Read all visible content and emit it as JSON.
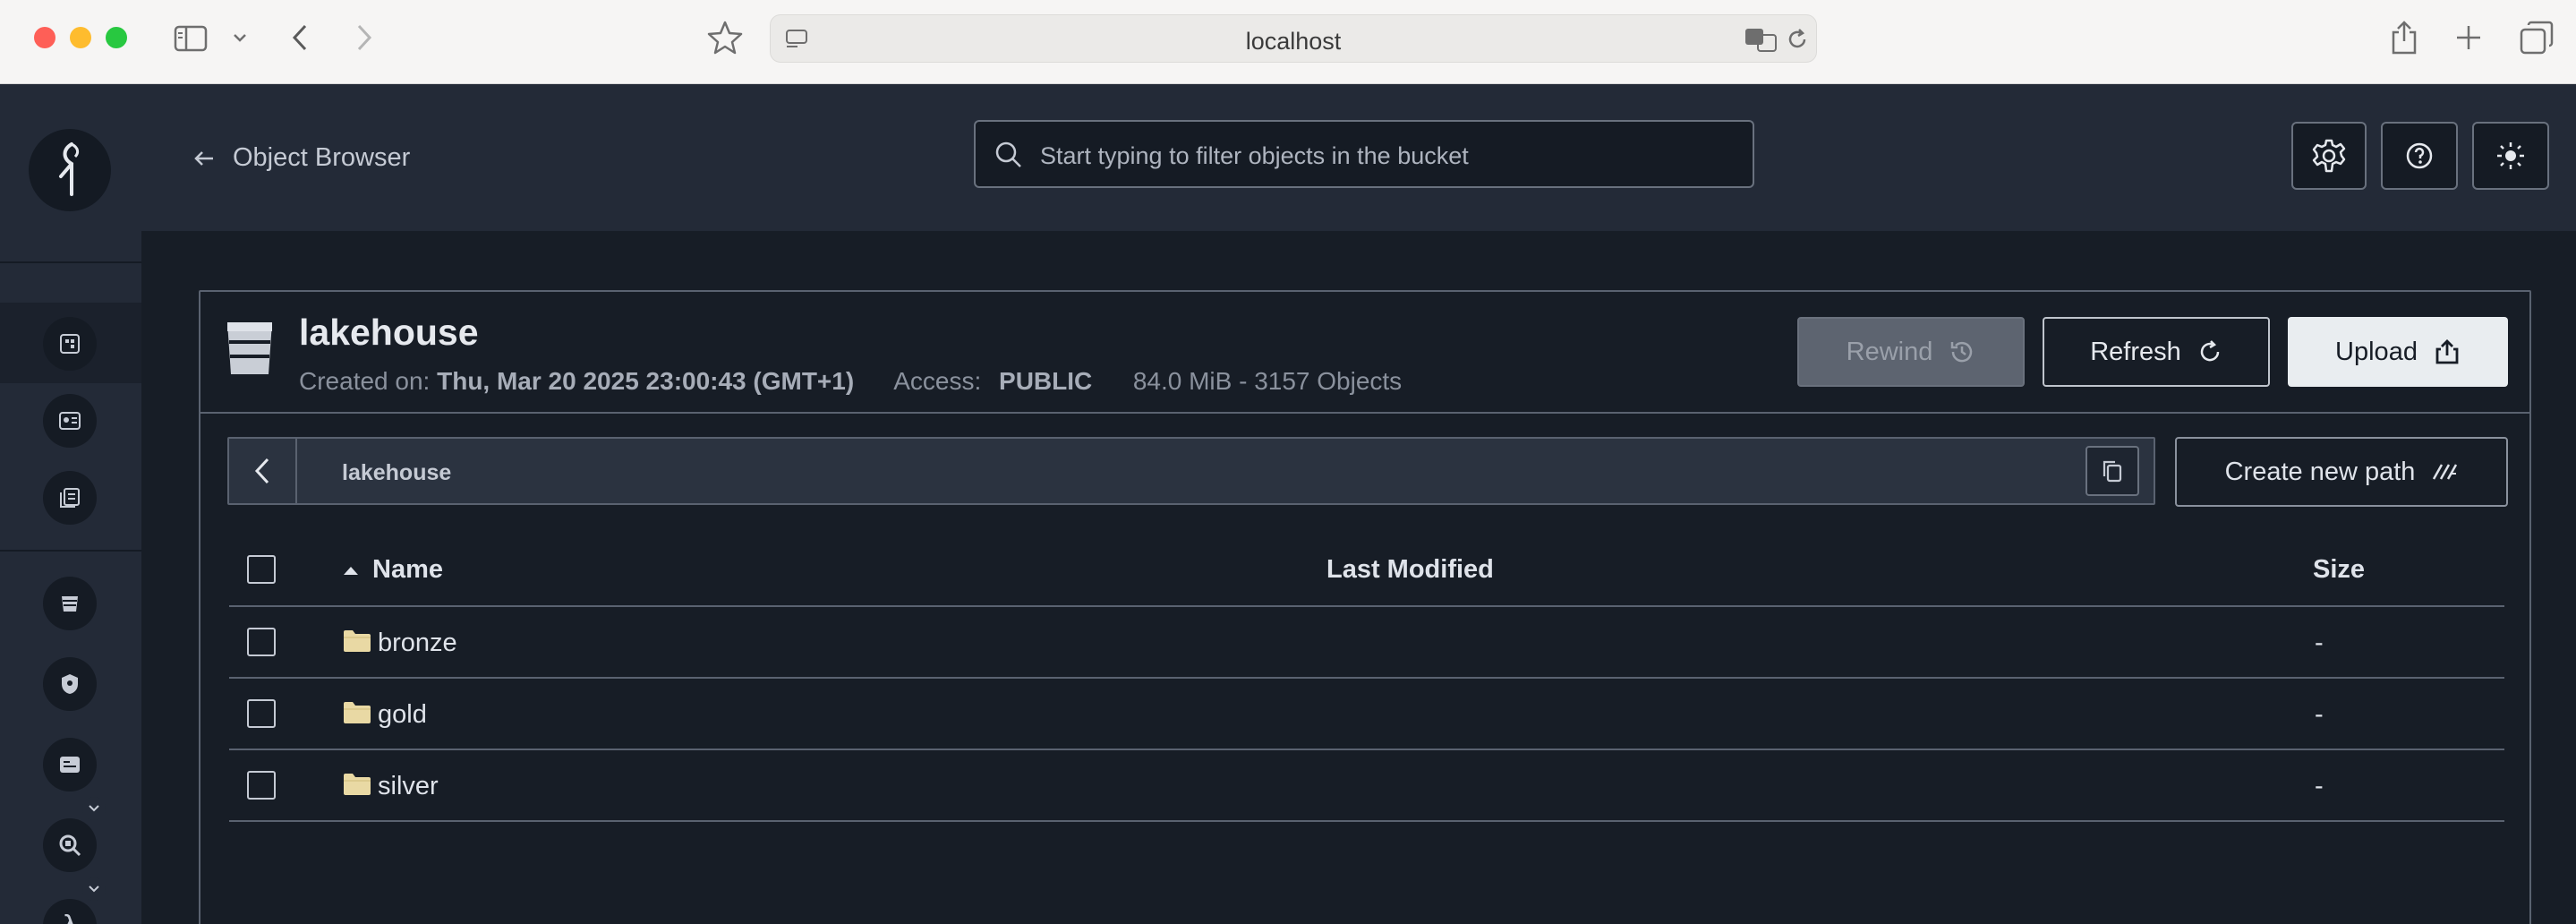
{
  "browser": {
    "url": "localhost"
  },
  "header": {
    "back_label": "Object Browser",
    "search_placeholder": "Start typing to filter objects in the bucket"
  },
  "bucket": {
    "name": "lakehouse",
    "created_label": "Created on:",
    "created_value": "Thu, Mar 20 2025 23:00:43 (GMT+1)",
    "access_label": "Access:",
    "access_value": "PUBLIC",
    "stats": "84.0 MiB - 3157 Objects"
  },
  "actions": {
    "rewind": "Rewind",
    "refresh": "Refresh",
    "upload": "Upload",
    "create_path": "Create new path"
  },
  "path": {
    "current": "lakehouse"
  },
  "table": {
    "columns": {
      "name": "Name",
      "last_modified": "Last Modified",
      "size": "Size"
    },
    "rows": [
      {
        "name": "bronze",
        "last_modified": "",
        "size": "-"
      },
      {
        "name": "gold",
        "last_modified": "",
        "size": "-"
      },
      {
        "name": "silver",
        "last_modified": "",
        "size": "-"
      }
    ]
  },
  "colors": {
    "background": "#171d26",
    "sidebar": "#232a37",
    "border": "#5a6270",
    "folder": "#e9d9a4",
    "upload_bg": "#e9edf0"
  },
  "icons": {
    "sidebar": [
      "buckets-icon",
      "access-icon",
      "documents-icon",
      "bucket-icon",
      "shield-icon",
      "identity-icon",
      "monitoring-icon",
      "lambda-icon"
    ]
  }
}
